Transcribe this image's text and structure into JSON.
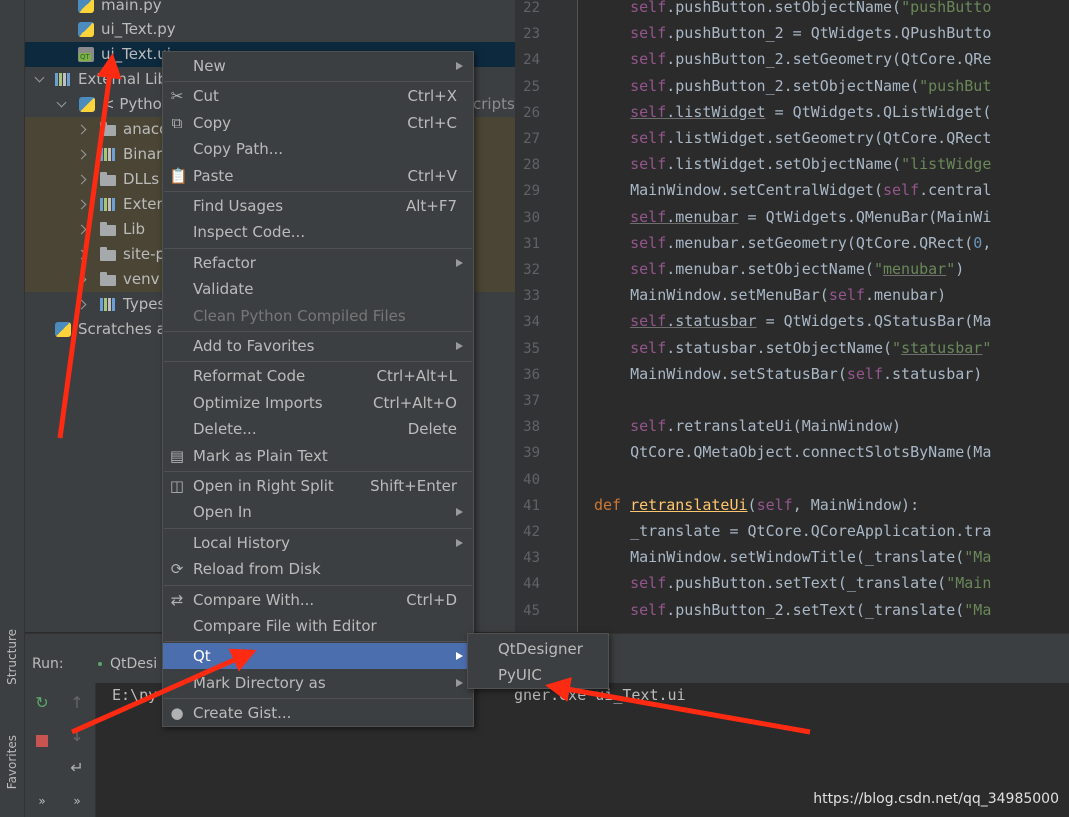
{
  "project_tree": [
    {
      "label": "main.py",
      "icon": "python-file-icon"
    },
    {
      "label": "ui_Text.py",
      "icon": "python-file-icon"
    },
    {
      "label": "ui_Text.ui",
      "icon": "qt-ui-file-icon",
      "selected": true
    },
    {
      "label": "External Libraries",
      "icon": "library-icon"
    },
    {
      "label": "< Python",
      "icon": "python-icon",
      "suffix": "cripts\\"
    },
    {
      "label": "anaco",
      "icon": "folder-icon"
    },
    {
      "label": "Binary",
      "icon": "library-icon"
    },
    {
      "label": "DLLs",
      "icon": "folder-icon"
    },
    {
      "label": "Exten",
      "icon": "library-icon"
    },
    {
      "label": "Lib",
      "icon": "folder-icon"
    },
    {
      "label": "site-p",
      "icon": "folder-icon"
    },
    {
      "label": "venv",
      "icon": "folder-icon"
    },
    {
      "label": "Types",
      "icon": "library-icon"
    },
    {
      "label": "Scratches a",
      "icon": "scratches-icon"
    }
  ],
  "side_tabs": {
    "structure": "Structure",
    "favorites": "Favorites"
  },
  "editor": {
    "lines": [
      {
        "n": "22",
        "html": "    <span class='kw-self'>self</span>.pushButton.setObjectName(<span class='str'>\"pushButto</span>"
      },
      {
        "n": "23",
        "html": "    <span class='kw-self'>self</span>.pushButton_2 = QtWidgets.QPushButto"
      },
      {
        "n": "24",
        "html": "    <span class='kw-self'>self</span>.pushButton_2.setGeometry(QtCore.QRe"
      },
      {
        "n": "25",
        "html": "    <span class='kw-self'>self</span>.pushButton_2.setObjectName(<span class='str'>\"pushBut</span>"
      },
      {
        "n": "26",
        "html": "    <span class='kw-self u'>self</span><span class='u'>.listWidget</span> = QtWidgets.QListWidget("
      },
      {
        "n": "27",
        "html": "    <span class='kw-self'>self</span>.listWidget.setGeometry(QtCore.QRect"
      },
      {
        "n": "28",
        "html": "    <span class='kw-self'>self</span>.listWidget.setObjectName(<span class='str'>\"listWidge</span>"
      },
      {
        "n": "29",
        "html": "    MainWindow.setCentralWidget(<span class='kw-self'>self</span>.central"
      },
      {
        "n": "30",
        "html": "    <span class='kw-self u'>self</span><span class='u'>.menubar</span> = QtWidgets.QMenuBar(MainWi"
      },
      {
        "n": "31",
        "html": "    <span class='kw-self'>self</span>.menubar.setGeometry(QtCore.QRect(<span class='num'>0</span>,"
      },
      {
        "n": "32",
        "html": "    <span class='kw-self'>self</span>.menubar.setObjectName(<span class='str'>\"<span class='u'>menubar</span>\"</span>)"
      },
      {
        "n": "33",
        "html": "    MainWindow.setMenuBar(<span class='kw-self'>self</span>.menubar)"
      },
      {
        "n": "34",
        "html": "    <span class='kw-self u'>self</span><span class='u'>.statusbar</span> = QtWidgets.QStatusBar(Ma"
      },
      {
        "n": "35",
        "html": "    <span class='kw-self'>self</span>.statusbar.setObjectName(<span class='str'>\"<span class='u'>statusbar</span>\"</span>"
      },
      {
        "n": "36",
        "html": "    MainWindow.setStatusBar(<span class='kw-self'>self</span>.statusbar)"
      },
      {
        "n": "37",
        "html": ""
      },
      {
        "n": "38",
        "html": "    <span class='kw-self'>self</span>.retranslateUi(MainWindow)"
      },
      {
        "n": "39",
        "html": "    QtCore.QMetaObject.connectSlotsByName(Ma"
      },
      {
        "n": "40",
        "html": ""
      },
      {
        "n": "41",
        "html": "<span class='kw-def'>def</span> <span class='fn-u'>retranslateUi</span>(<span class='kw-self'>self</span>, MainWindow):"
      },
      {
        "n": "42",
        "html": "    _translate = QtCore.QCoreApplication.tra"
      },
      {
        "n": "43",
        "html": "    MainWindow.setWindowTitle(_translate(<span class='str'>\"Ma</span>"
      },
      {
        "n": "44",
        "html": "    <span class='kw-self'>self</span>.pushButton.setText(_translate(<span class='str'>\"Main</span>"
      },
      {
        "n": "45",
        "html": "    <span class='kw-self'>self</span>.pushButton_2.setText(_translate(<span class='str'>\"Ma</span>"
      }
    ]
  },
  "run_panel": {
    "label": "Run:",
    "tab": "QtDesi",
    "output_prefix": "E:\\py",
    "output_suffix": "gner.exe ui_Text.ui",
    "more_left": "»",
    "more_right": "»"
  },
  "context_menu": {
    "items": [
      {
        "label": "New",
        "shortcut": "",
        "submenu": true,
        "icon": ""
      },
      {
        "sep": true
      },
      {
        "label": "Cut",
        "shortcut": "Ctrl+X",
        "icon": "✂",
        "name": "cut"
      },
      {
        "label": "Copy",
        "shortcut": "Ctrl+C",
        "icon": "⧉",
        "name": "copy"
      },
      {
        "label": "Copy Path...",
        "shortcut": "",
        "name": "copy-path"
      },
      {
        "label": "Paste",
        "shortcut": "Ctrl+V",
        "icon": "📋",
        "name": "paste"
      },
      {
        "sep": true
      },
      {
        "label": "Find Usages",
        "shortcut": "Alt+F7",
        "name": "find-usages"
      },
      {
        "label": "Inspect Code...",
        "shortcut": "",
        "name": "inspect-code"
      },
      {
        "sep": true
      },
      {
        "label": "Refactor",
        "shortcut": "",
        "submenu": true,
        "name": "refactor"
      },
      {
        "label": "Validate",
        "shortcut": "",
        "name": "validate"
      },
      {
        "label": "Clean Python Compiled Files",
        "shortcut": "",
        "disabled": true,
        "name": "clean-compiled"
      },
      {
        "sep": true
      },
      {
        "label": "Add to Favorites",
        "shortcut": "",
        "submenu": true,
        "name": "add-to-favorites"
      },
      {
        "sep": true
      },
      {
        "label": "Reformat Code",
        "shortcut": "Ctrl+Alt+L",
        "name": "reformat-code"
      },
      {
        "label": "Optimize Imports",
        "shortcut": "Ctrl+Alt+O",
        "name": "optimize-imports"
      },
      {
        "label": "Delete...",
        "shortcut": "Delete",
        "name": "delete"
      },
      {
        "label": "Mark as Plain Text",
        "shortcut": "",
        "icon": "▤",
        "name": "mark-plain-text"
      },
      {
        "sep": true
      },
      {
        "label": "Open in Right Split",
        "shortcut": "Shift+Enter",
        "icon": "◫",
        "name": "open-right-split"
      },
      {
        "label": "Open In",
        "shortcut": "",
        "submenu": true,
        "name": "open-in"
      },
      {
        "sep": true
      },
      {
        "label": "Local History",
        "shortcut": "",
        "submenu": true,
        "name": "local-history"
      },
      {
        "label": "Reload from Disk",
        "shortcut": "",
        "icon": "⟳",
        "name": "reload-from-disk"
      },
      {
        "sep": true
      },
      {
        "label": "Compare With...",
        "shortcut": "Ctrl+D",
        "icon": "⇄",
        "name": "compare-with"
      },
      {
        "label": "Compare File with Editor",
        "shortcut": "",
        "name": "compare-file-editor"
      },
      {
        "sep": true
      },
      {
        "label": "Qt",
        "shortcut": "",
        "submenu": true,
        "active": true,
        "name": "qt"
      },
      {
        "label": "Mark Directory as",
        "shortcut": "",
        "submenu": true,
        "name": "mark-directory-as"
      },
      {
        "sep": true
      },
      {
        "label": "Create Gist...",
        "shortcut": "",
        "icon": "●",
        "name": "create-gist"
      }
    ]
  },
  "qt_submenu": {
    "items": [
      "QtDesigner",
      "PyUIC"
    ]
  },
  "watermark": "https://blog.csdn.net/qq_34985000",
  "colors": {
    "accent": "#4b6eaf",
    "annotation": "#ff2a12"
  }
}
